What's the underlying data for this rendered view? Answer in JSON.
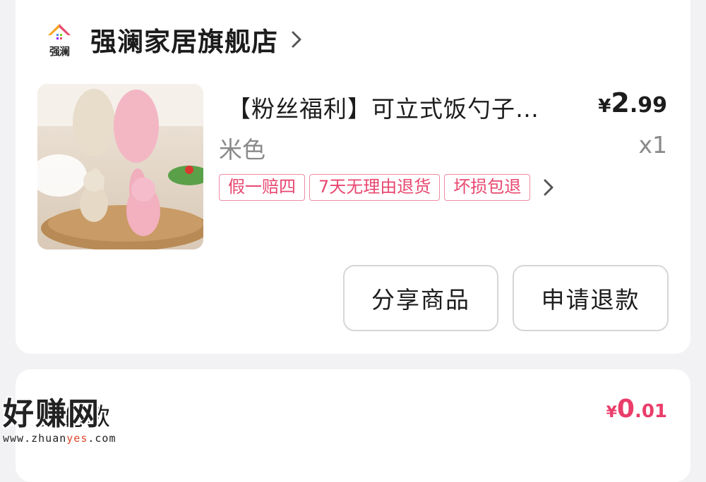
{
  "store": {
    "logo_text": "强澜",
    "name": "强澜家居旗舰店"
  },
  "product": {
    "title": "【粉丝福利】可立式饭勺子…",
    "price_currency": "¥",
    "price_int": "2",
    "price_dec": ".99",
    "variant": "米色",
    "quantity": "x1",
    "tags": [
      "假一赔四",
      "7天无理由退货",
      "坏损包退"
    ]
  },
  "actions": {
    "share_label": "分享商品",
    "refund_label": "申请退款"
  },
  "payment": {
    "label": "实付款",
    "currency": "¥",
    "amount_int": "0",
    "amount_dec": ".01"
  },
  "watermark": {
    "text": "好赚网",
    "url_prefix": "www.zhuan",
    "url_accent": "yes",
    "url_suffix": ".com"
  },
  "colors": {
    "accent": "#ea3d6a",
    "tag_border": "#f08ca4",
    "text_primary": "#1c1c1c",
    "text_secondary": "#8a8a8a"
  }
}
